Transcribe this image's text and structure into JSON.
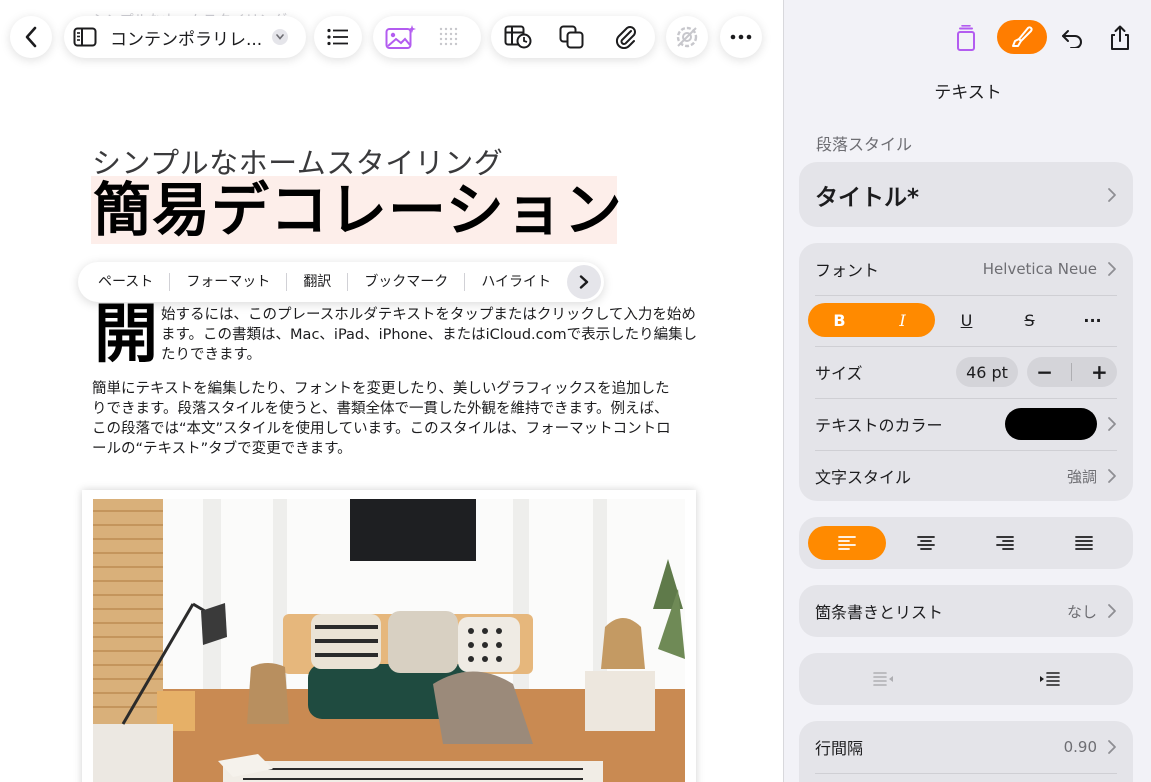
{
  "toolbar": {
    "document_name": "コンテンポラリレ...",
    "ghost_title": "シンプルなホームスタイリング"
  },
  "document": {
    "subtitle": "シンプルなホームスタイリング",
    "title": "簡易デコレーション",
    "drop_cap": "開",
    "paragraph1": "始するには、このプレースホルダテキストをタップまたはクリックして入力を始めます。この書類は、Mac、iPad、iPhone、またはiCloud.comで表示したり編集したりできます。",
    "paragraph2": "簡単にテキストを編集したり、フォントを変更したり、美しいグラフィックスを追加したりできます。段落スタイルを使うと、書類全体で一貫した外観を維持できます。例えば、この段落では“本文”スタイルを使用しています。このスタイルは、フォーマットコントロールの“テキスト”タブで変更できます。"
  },
  "context_menu": {
    "items": [
      "ペースト",
      "フォーマット",
      "翻訳",
      "ブックマーク",
      "ハイライト"
    ]
  },
  "panel": {
    "title": "テキスト",
    "section_label": "段落スタイル",
    "paragraph_style": "タイトル*",
    "font_label": "フォント",
    "font_value": "Helvetica Neue",
    "style_buttons": {
      "bold": "B",
      "italic": "I",
      "underline": "U",
      "strike": "S",
      "more": "···"
    },
    "size_label": "サイズ",
    "size_value": "46 pt",
    "size_minus": "−",
    "size_plus": "+",
    "color_label": "テキストのカラー",
    "text_color": "#000000",
    "char_style_label": "文字スタイル",
    "char_style_value": "強調",
    "bullets_label": "箇条書きとリスト",
    "bullets_value": "なし",
    "line_spacing_label": "行間隔",
    "line_spacing_value": "0.90"
  },
  "colors": {
    "accent": "#FF7D00",
    "title_highlight": "#FDEEEA",
    "panel_background": "#F2F2F7",
    "card_background": "#E4E4E9"
  }
}
